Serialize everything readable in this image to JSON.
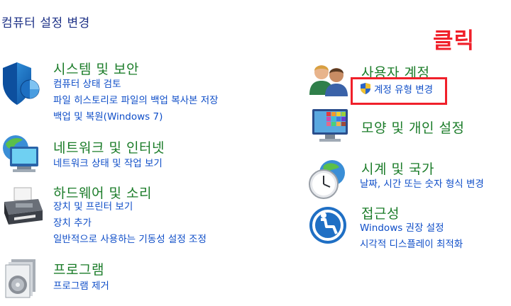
{
  "page": {
    "title": "컴퓨터 설정 변경"
  },
  "annotation": {
    "text": "클릭",
    "color": "#f0202a"
  },
  "colors": {
    "category_title": "#1b7c29",
    "link": "#0f4ec8",
    "header": "#1e3287"
  },
  "categories": [
    {
      "id": "system-security",
      "icon": "shield-icon",
      "title": "시스템 및 보안",
      "links": [
        "컴퓨터 상태 검토",
        "파일 히스토리로 파일의 백업 복사본 저장",
        "백업 및 복원(Windows 7)"
      ]
    },
    {
      "id": "network",
      "icon": "network-globe-icon",
      "title": "네트워크 및 인터넷",
      "links": [
        "네트워크 상태 및 작업 보기"
      ]
    },
    {
      "id": "hardware-sound",
      "icon": "printer-icon",
      "title": "하드웨어 및 소리",
      "links": [
        "장치 및 프린터 보기",
        "장치 추가",
        "일반적으로 사용하는 기동성 설정 조정"
      ]
    },
    {
      "id": "programs",
      "icon": "programs-disc-icon",
      "title": "프로그램",
      "links": [
        "프로그램 제거"
      ]
    },
    {
      "id": "user-accounts",
      "icon": "users-icon",
      "title": "사용자 계정",
      "links": [
        "계정 유형 변경"
      ]
    },
    {
      "id": "appearance",
      "icon": "monitor-palette-icon",
      "title": "모양 및 개인 설정",
      "links": []
    },
    {
      "id": "clock-region",
      "icon": "clock-globe-icon",
      "title": "시계 및 국가",
      "links": [
        "날짜, 시간 또는 숫자 형식 변경"
      ]
    },
    {
      "id": "ease-of-access",
      "icon": "ease-of-access-icon",
      "title": "접근성",
      "links": [
        "Windows 권장 설정",
        "시각적 디스플레이 최적화"
      ]
    }
  ]
}
